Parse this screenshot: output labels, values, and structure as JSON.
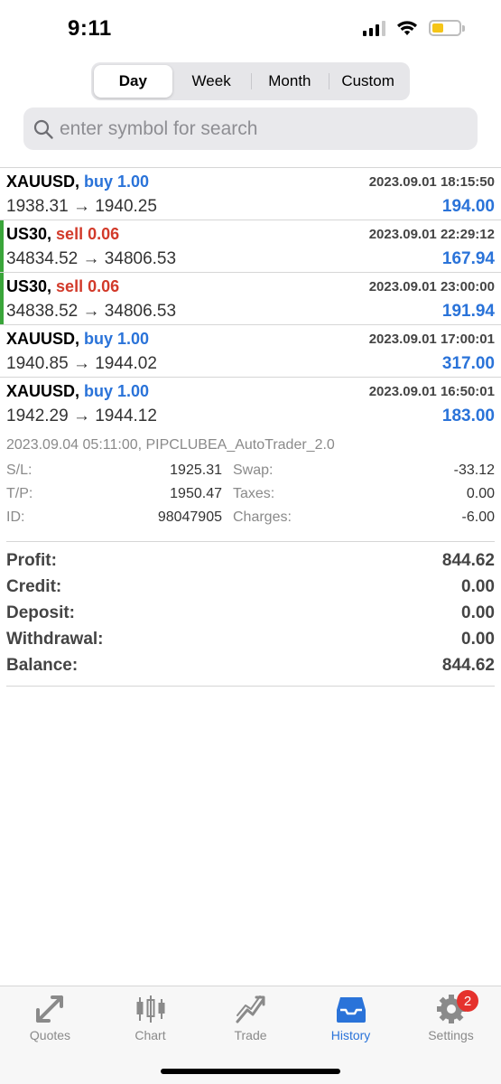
{
  "status_bar": {
    "time": "9:11"
  },
  "period_tabs": [
    {
      "label": "Day",
      "active": true
    },
    {
      "label": "Week",
      "active": false
    },
    {
      "label": "Month",
      "active": false
    },
    {
      "label": "Custom",
      "active": false
    }
  ],
  "search": {
    "placeholder": "enter symbol for search"
  },
  "trades": [
    {
      "symbol": "XAUUSD,",
      "side": "buy 1.00",
      "time": "2023.09.01 18:15:50",
      "prices": "1938.31 → 1940.25",
      "profit": "194.00"
    },
    {
      "symbol": "US30,",
      "side": "sell 0.06",
      "time": "2023.09.01 22:29:12",
      "prices": "34834.52 → 34806.53",
      "profit": "167.94"
    },
    {
      "symbol": "US30,",
      "side": "sell 0.06",
      "time": "2023.09.01 23:00:00",
      "prices": "34838.52 → 34806.53",
      "profit": "191.94"
    },
    {
      "symbol": "XAUUSD,",
      "side": "buy 1.00",
      "time": "2023.09.01 17:00:01",
      "prices": "1940.85 → 1944.02",
      "profit": "317.00"
    },
    {
      "symbol": "XAUUSD,",
      "side": "buy 1.00",
      "time": "2023.09.01 16:50:01",
      "prices": "1942.29 → 1944.12",
      "profit": "183.00"
    }
  ],
  "details": {
    "title": "2023.09.04 05:11:00, PIPCLUBEA_AutoTrader_2.0",
    "rows": [
      {
        "l1": "S/L:",
        "v1": "1925.31",
        "l2": "Swap:",
        "v2": "-33.12"
      },
      {
        "l1": "T/P:",
        "v1": "1950.47",
        "l2": "Taxes:",
        "v2": "0.00"
      },
      {
        "l1": "ID:",
        "v1": "98047905",
        "l2": "Charges:",
        "v2": "-6.00"
      }
    ]
  },
  "summary": [
    {
      "label": "Profit:",
      "value": "844.62"
    },
    {
      "label": "Credit:",
      "value": "0.00"
    },
    {
      "label": "Deposit:",
      "value": "0.00"
    },
    {
      "label": "Withdrawal:",
      "value": "0.00"
    },
    {
      "label": "Balance:",
      "value": "844.62"
    }
  ],
  "tabbar": {
    "quotes": "Quotes",
    "chart": "Chart",
    "trade": "Trade",
    "history": "History",
    "settings": "Settings",
    "settings_badge": "2"
  },
  "colors": {
    "accent": "#2a73d9",
    "sell": "#d23a2a",
    "marker": "#3aa53a"
  }
}
